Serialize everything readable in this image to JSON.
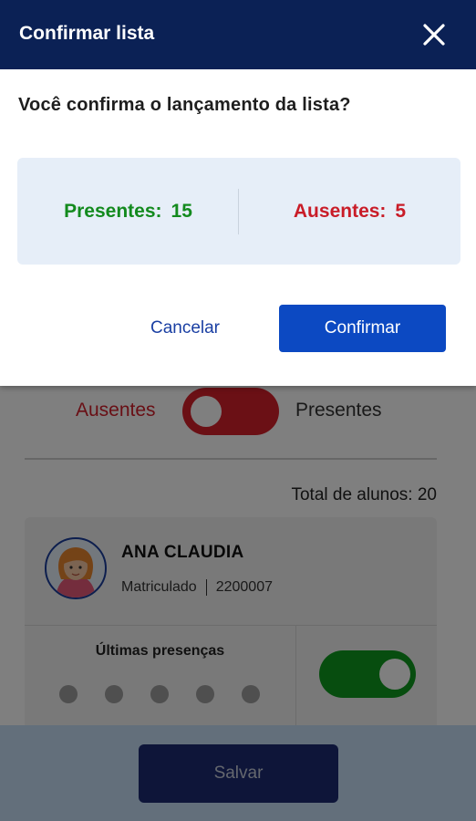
{
  "dialog": {
    "title": "Confirmar lista",
    "question": "Você confirma o lançamento da lista?",
    "presentes_label": "Presentes:",
    "presentes_count": "15",
    "ausentes_label": "Ausentes:",
    "ausentes_count": "5",
    "cancel_label": "Cancelar",
    "confirm_label": "Confirmar",
    "colors": {
      "header": "#0b2155",
      "presentes": "#138a1e",
      "ausentes": "#c91c28",
      "confirm": "#0c49c2"
    },
    "close_icon": "close-icon"
  },
  "filter": {
    "left_label": "Ausentes",
    "right_label": "Presentes",
    "state": "Ausentes"
  },
  "total_label": "Total de alunos: 20",
  "student": {
    "name": "ANA CLAUDIA",
    "status": "Matriculado",
    "id": "2200007",
    "recent_label": "Últimas presenças",
    "recent_count": 5,
    "present_toggle": true,
    "avatar_icon": "avatar"
  },
  "footer": {
    "save_label": "Salvar"
  }
}
